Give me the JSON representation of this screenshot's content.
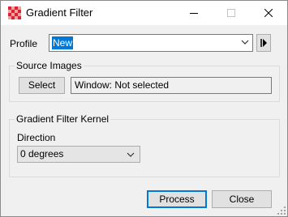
{
  "window": {
    "title": "Gradient Filter",
    "icon": "grid-checker-icon",
    "controls": {
      "minimize": "minimize-icon",
      "maximize": "maximize-icon",
      "close": "close-icon"
    }
  },
  "profile": {
    "label": "Profile",
    "value": "New",
    "play_icon": "play-to-end-icon"
  },
  "source_images": {
    "legend": "Source Images",
    "select_label": "Select",
    "status": "Window: Not selected"
  },
  "kernel": {
    "legend": "Gradient Filter Kernel",
    "direction_label": "Direction",
    "direction_value": "0 degrees"
  },
  "footer": {
    "process_label": "Process",
    "close_label": "Close"
  },
  "colors": {
    "accent": "#0078d7",
    "icon_red": "#d9262c"
  }
}
